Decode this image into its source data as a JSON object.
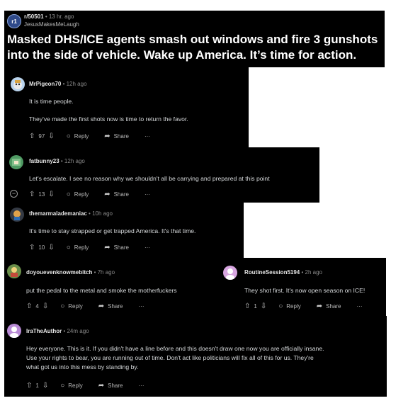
{
  "post": {
    "subreddit_icon": "r1",
    "subreddit": "r/50501",
    "time": "13 hr. ago",
    "username": "JesusMakesMeLaugh",
    "title_line1": "Masked DHS/ICE agents smash out windows and fire 3 gunshots",
    "title_line2": "into the side of vehicle. Wake up America. It’s time for action."
  },
  "comments": [
    {
      "author": "MrPigeon70",
      "time": "12h ago",
      "lines": [
        "It is time people.",
        "They've made the first shots now is time to return the favor."
      ],
      "score": "97",
      "reply": "Reply",
      "share": "Share",
      "more": "···"
    },
    {
      "author": "fatbunny23",
      "time": "12h ago",
      "lines": [
        "Let's escalate. I see no reason why we shouldn't all be carrying and prepared at this point"
      ],
      "score": "13",
      "reply": "Reply",
      "share": "Share",
      "more": "···",
      "collapse": "−"
    },
    {
      "author": "themarmalademaniac",
      "time": "10h ago",
      "lines": [
        "It's time to stay strapped or get trapped America. It's that time."
      ],
      "score": "10",
      "reply": "Reply",
      "share": "Share",
      "more": "···"
    },
    {
      "author": "doyouevenknowmebitch",
      "time": "7h ago",
      "lines": [
        "put the pedal to the metal and smoke the motherfuckers"
      ],
      "score": "4",
      "reply": "Reply",
      "share": "Share",
      "more": "···"
    },
    {
      "author": "RoutineSession5194",
      "time": "2h ago",
      "lines": [
        "They shot first. It's now open season on ICE!"
      ],
      "score": "1",
      "reply": "Reply",
      "share": "Share",
      "more": "···"
    },
    {
      "author": "IraTheAuthor",
      "time": "24m ago",
      "lines": [
        "Hey everyone. This is it. If you didn't have a line before and this doesn't draw one now you are officially insane.",
        "Use your rights to bear, you are running out of time. Don't act like politicians will fix all of this for us. They're",
        "what got us into this mess by standing by."
      ],
      "score": "1",
      "reply": "Reply",
      "share": "Share",
      "more": "···"
    }
  ],
  "icons": {
    "upvote": "upvote-icon",
    "downvote": "downvote-icon",
    "reply": "reply-icon",
    "share": "share-icon",
    "more": "more-icon"
  },
  "colors": {
    "background": "#000000",
    "page": "#ffffff",
    "text": "#d7dadc",
    "muted": "#8a8a8a"
  }
}
